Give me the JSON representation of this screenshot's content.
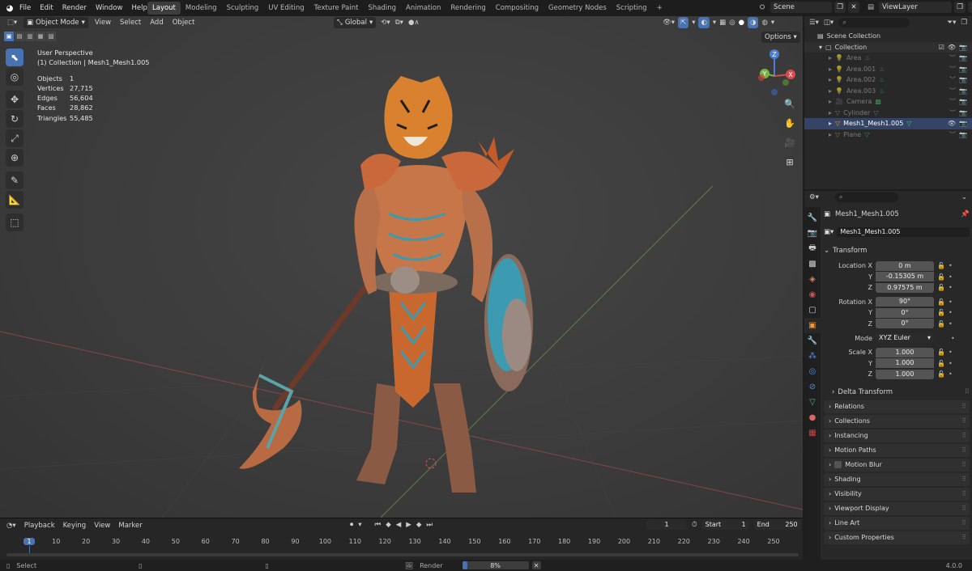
{
  "menus": [
    "File",
    "Edit",
    "Render",
    "Window",
    "Help"
  ],
  "workspaces": [
    "Layout",
    "Modeling",
    "Sculpting",
    "UV Editing",
    "Texture Paint",
    "Shading",
    "Animation",
    "Rendering",
    "Compositing",
    "Geometry Nodes",
    "Scripting"
  ],
  "active_workspace": "Layout",
  "scene": "Scene",
  "viewlayer": "ViewLayer",
  "viewport": {
    "mode": "Object Mode",
    "header_menus": [
      "View",
      "Select",
      "Add",
      "Object"
    ],
    "transform_orientation": "Global",
    "options": "Options",
    "title": "User Perspective",
    "collection_line": "(1) Collection | Mesh1_Mesh1.005",
    "stats": [
      {
        "label": "Objects",
        "value": "1"
      },
      {
        "label": "Vertices",
        "value": "27,715"
      },
      {
        "label": "Edges",
        "value": "56,604"
      },
      {
        "label": "Faces",
        "value": "28,862"
      },
      {
        "label": "Triangles",
        "value": "55,485"
      }
    ],
    "gizmo": {
      "z": "Z",
      "x": "X",
      "y": "Y"
    }
  },
  "outliner": {
    "root": "Scene Collection",
    "collection": "Collection",
    "items": [
      "Area",
      "Area.001",
      "Area.002",
      "Area.003",
      "Camera",
      "Cylinder",
      "Mesh1_Mesh1.005",
      "Plane"
    ]
  },
  "properties": {
    "object_name": "Mesh1_Mesh1.005",
    "data_name": "Mesh1_Mesh1.005",
    "transform_label": "Transform",
    "location": {
      "label": "Location X",
      "x": "0 m",
      "y": "-0.15305 m",
      "z": "0.97575 m"
    },
    "rotation": {
      "label": "Rotation X",
      "x": "90°",
      "y": "0°",
      "z": "0°"
    },
    "mode_label": "Mode",
    "mode_value": "XYZ Euler",
    "scale": {
      "label": "Scale X",
      "x": "1.000",
      "y": "1.000",
      "z": "1.000"
    },
    "axis_y": "Y",
    "axis_z": "Z",
    "delta_transform": "Delta Transform",
    "panels": [
      "Relations",
      "Collections",
      "Instancing",
      "Motion Paths",
      "Motion Blur",
      "Shading",
      "Visibility",
      "Viewport Display",
      "Line Art",
      "Custom Properties"
    ]
  },
  "timeline": {
    "menus": [
      "Playback",
      "Keying",
      "View",
      "Marker"
    ],
    "current_frame": "1",
    "start_label": "Start",
    "start": "1",
    "end_label": "End",
    "end": "250",
    "ticks": [
      "1",
      "10",
      "20",
      "30",
      "40",
      "50",
      "60",
      "70",
      "80",
      "90",
      "100",
      "110",
      "120",
      "130",
      "140",
      "150",
      "160",
      "170",
      "180",
      "190",
      "200",
      "210",
      "220",
      "230",
      "240",
      "250"
    ]
  },
  "status": {
    "select": "Select",
    "render": "Render",
    "progress": "8%",
    "progress_fraction": 0.08,
    "version": "4.0.0"
  }
}
